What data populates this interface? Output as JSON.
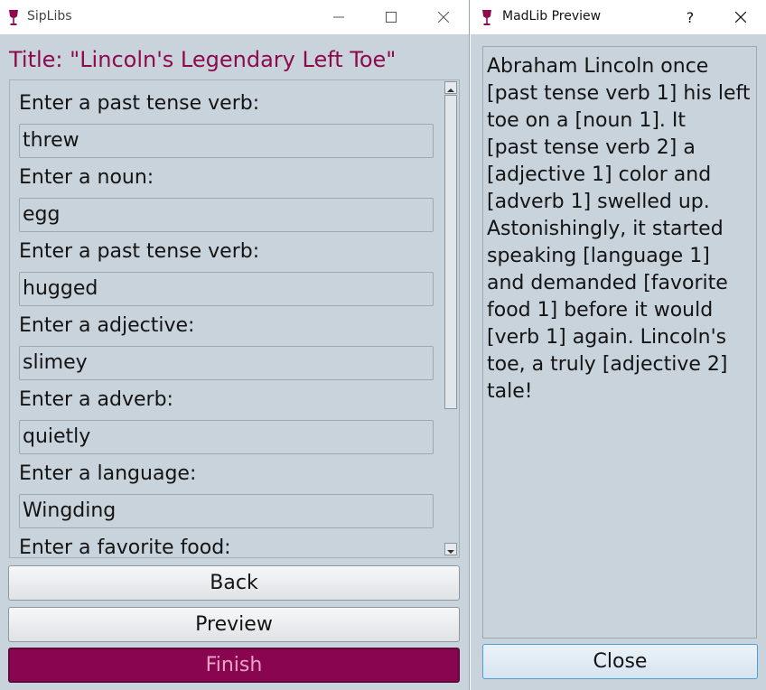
{
  "left_window": {
    "app_title": "SipLibs",
    "doc_title": "Title: \"Lincoln's Legendary Left Toe\"",
    "fields": [
      {
        "prompt": "Enter a past tense verb:",
        "value": "threw"
      },
      {
        "prompt": "Enter a noun:",
        "value": "egg"
      },
      {
        "prompt": "Enter a past tense verb:",
        "value": "hugged"
      },
      {
        "prompt": "Enter a adjective:",
        "value": "slimey"
      },
      {
        "prompt": "Enter a adverb:",
        "value": "quietly"
      },
      {
        "prompt": "Enter a language:",
        "value": "Wingding"
      },
      {
        "prompt": "Enter a favorite food:",
        "value": ""
      }
    ],
    "buttons": {
      "back": "Back",
      "preview": "Preview",
      "finish": "Finish"
    }
  },
  "right_window": {
    "title": "MadLib Preview",
    "help": "?",
    "story_lines": [
      "Abraham Lincoln once",
      "[past tense verb 1] his left",
      "toe on a [noun 1]. It",
      "[past tense verb 2] a",
      "[adjective 1] color and",
      "[adverb 1] swelled up.",
      "Astonishingly, it started",
      "speaking [language 1]",
      "and demanded [favorite",
      "food 1] before it would",
      "[verb 1] again. Lincoln's",
      "toe, a truly [adjective 2]",
      "tale!"
    ],
    "close_label": "Close"
  },
  "icons": {
    "app": "wine-glass-icon",
    "minimize": "minimize-icon",
    "maximize": "maximize-icon",
    "close": "close-icon"
  },
  "colors": {
    "accent": "#8e0a4f",
    "finish_bg": "#8a0550",
    "finish_text": "#e7a6c6",
    "window_bg": "#c8d3db"
  }
}
